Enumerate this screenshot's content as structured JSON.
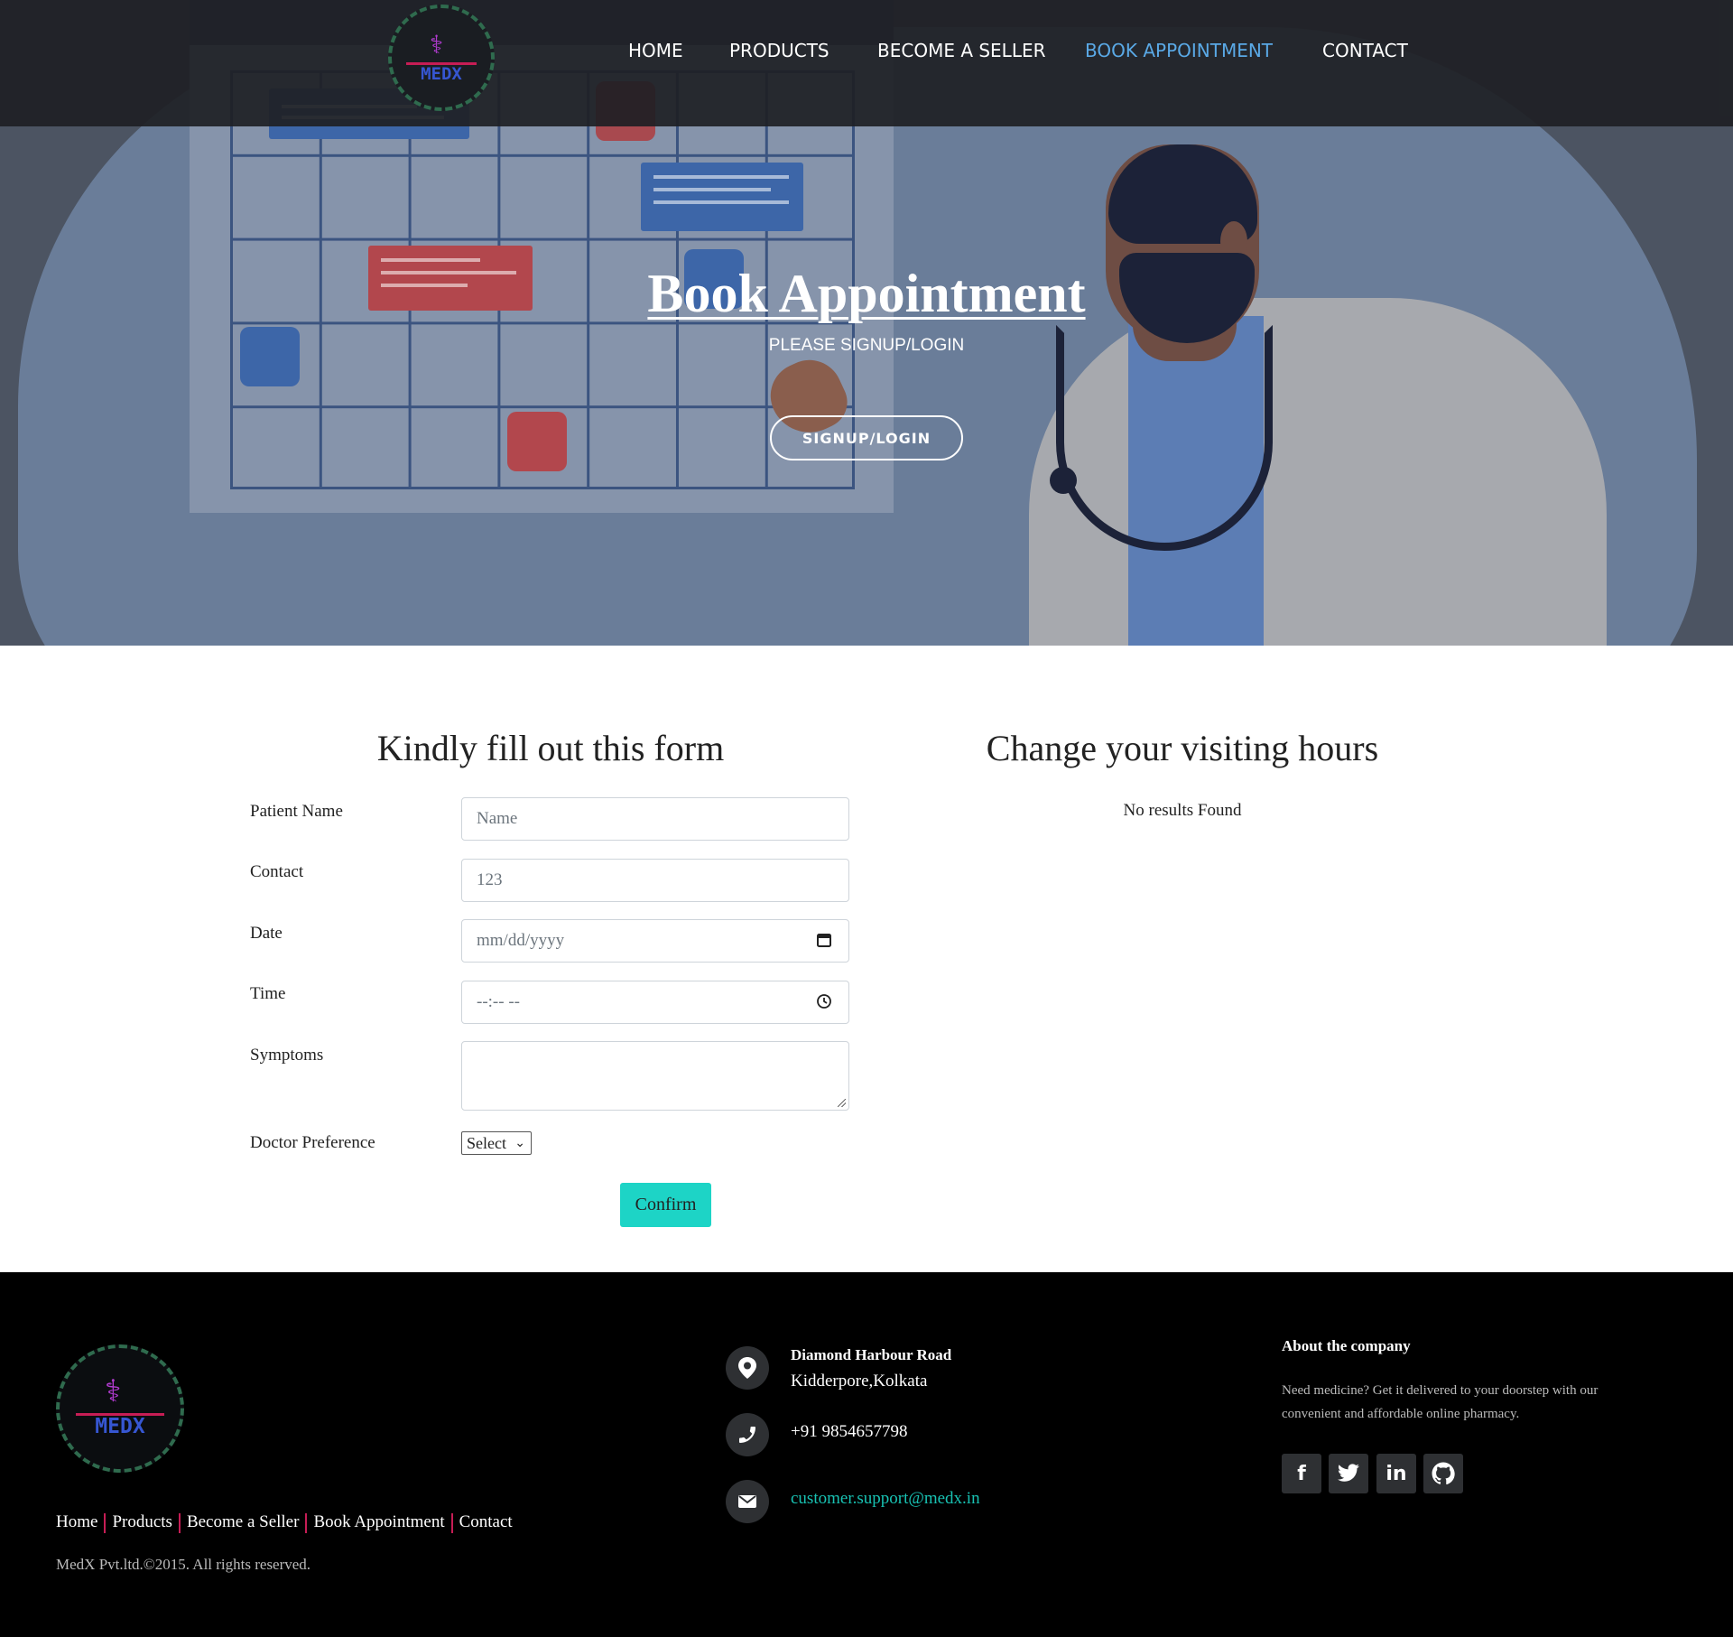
{
  "nav": {
    "logo_text": "MEDX",
    "links": [
      {
        "label": "HOME"
      },
      {
        "label": "PRODUCTS"
      },
      {
        "label": "BECOME A SELLER"
      },
      {
        "label": "BOOK APPOINTMENT",
        "active": true
      },
      {
        "label": "CONTACT"
      }
    ],
    "active_color": "#5aa9e6"
  },
  "hero": {
    "title": "Book Appointment",
    "subtitle": "PLEASE SIGNUP/LOGIN",
    "button_label": "SIGNUP/LOGIN"
  },
  "form": {
    "title": "Kindly fill out this form",
    "fields": {
      "patient_name": {
        "label": "Patient Name",
        "placeholder": "Name"
      },
      "contact": {
        "label": "Contact",
        "placeholder": "123"
      },
      "date": {
        "label": "Date",
        "placeholder": "mm/dd/yyyy",
        "icon": "calendar-icon"
      },
      "time": {
        "label": "Time",
        "placeholder": "--:-- --",
        "icon": "clock-icon"
      },
      "symptoms": {
        "label": "Symptoms",
        "value": ""
      },
      "doctor": {
        "label": "Doctor Preference",
        "selected": "Select"
      }
    },
    "confirm_label": "Confirm",
    "confirm_color": "#1dd4c6"
  },
  "visiting": {
    "title": "Change your visiting hours",
    "empty_text": "No results Found"
  },
  "footer": {
    "logo_text": "MEDX",
    "links": [
      "Home",
      "Products",
      "Become a Seller",
      "Book Appointment",
      "Contact"
    ],
    "copyright": "MedX Pvt.ltd.©2015. All rights reserved.",
    "address_line1": "Diamond Harbour Road",
    "address_line2": "Kidderpore,Kolkata",
    "phone": "+91 9854657798",
    "email": "customer.support@medx.in",
    "about_title": "About the company",
    "about_text": "Need medicine? Get it delivered to your doorstep with our convenient and affordable online pharmacy.",
    "social_icons": [
      "facebook-icon",
      "twitter-icon",
      "linkedin-icon",
      "github-icon"
    ],
    "email_color": "#18c2b3"
  }
}
